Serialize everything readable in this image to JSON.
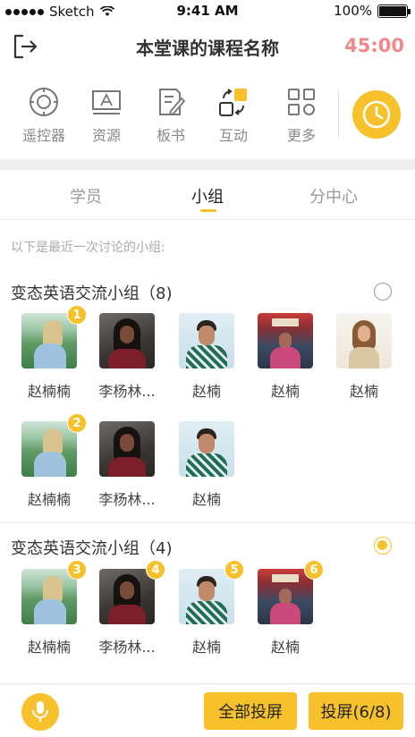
{
  "status_bar": {
    "carrier": "Sketch",
    "time": "9:41 AM",
    "battery": "100%",
    "battery_level": 1.0
  },
  "header": {
    "title": "本堂课的课程名称",
    "timer": "45:00",
    "exit_icon": "exit-icon"
  },
  "toolbar": {
    "items": [
      {
        "label": "遥控器",
        "icon": "remote-control-icon"
      },
      {
        "label": "资源",
        "icon": "resource-icon"
      },
      {
        "label": "板书",
        "icon": "blackboard-icon"
      },
      {
        "label": "互动",
        "icon": "interaction-icon"
      },
      {
        "label": "更多",
        "icon": "more-grid-icon"
      }
    ],
    "clock_icon": "clock-icon"
  },
  "tabs": [
    {
      "label": "学员",
      "active": false
    },
    {
      "label": "小组",
      "active": true
    },
    {
      "label": "分中心",
      "active": false
    }
  ],
  "hint": "以下是最近一次讨论的小组:",
  "groups": [
    {
      "title": "变态英语交流小组（8)",
      "selected": false,
      "members": [
        {
          "name": "赵楠楠",
          "badge": "1"
        },
        {
          "name": "李杨林...",
          "badge": ""
        },
        {
          "name": "赵楠",
          "badge": ""
        },
        {
          "name": "赵楠",
          "badge": ""
        },
        {
          "name": "赵楠",
          "badge": ""
        },
        {
          "name": "赵楠楠",
          "badge": "2"
        },
        {
          "name": "李杨林...",
          "badge": ""
        },
        {
          "name": "赵楠",
          "badge": ""
        }
      ]
    },
    {
      "title": "变态英语交流小组（4)",
      "selected": true,
      "members": [
        {
          "name": "赵楠楠",
          "badge": "3"
        },
        {
          "name": "李杨林...",
          "badge": "4"
        },
        {
          "name": "赵楠",
          "badge": "5"
        },
        {
          "name": "赵楠",
          "badge": "6"
        }
      ]
    }
  ],
  "bottom_bar": {
    "mic_icon": "microphone-icon",
    "all_cast_label": "全部投屏",
    "cast_label": "投屏(6/8)"
  },
  "colors": {
    "accent": "#f6c12a",
    "timer": "#f08a8a",
    "muted_text": "#999999"
  }
}
